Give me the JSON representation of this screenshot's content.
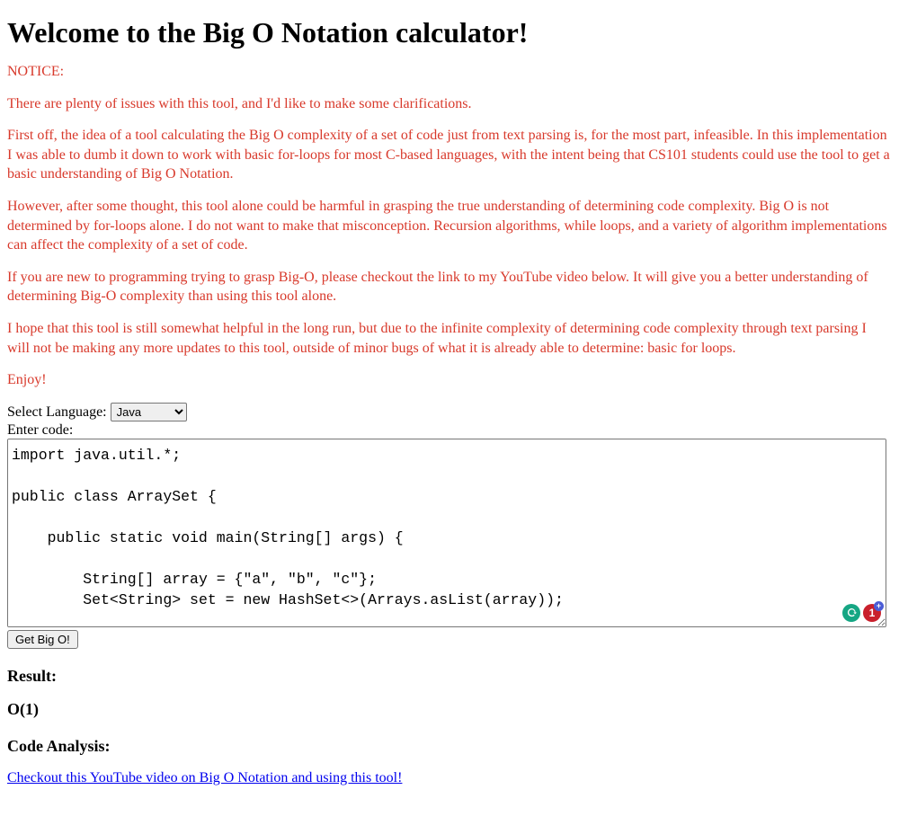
{
  "page_title": "Welcome to the Big O Notation calculator!",
  "notice": {
    "heading": "NOTICE:",
    "p1": "There are plenty of issues with this tool, and I'd like to make some clarifications.",
    "p2": "First off, the idea of a tool calculating the Big O complexity of a set of code just from text parsing is, for the most part, infeasible. In this implementation I was able to dumb it down to work with basic for-loops for most C-based languages, with the intent being that CS101 students could use the tool to get a basic understanding of Big O Notation.",
    "p3": "However, after some thought, this tool alone could be harmful in grasping the true understanding of determining code complexity. Big O is not determined by for-loops alone. I do not want to make that misconception. Recursion algorithms, while loops, and a variety of algorithm implementations can affect the complexity of a set of code.",
    "p4": "If you are new to programming trying to grasp Big-O, please checkout the link to my YouTube video below. It will give you a better understanding of determining Big-O complexity than using this tool alone.",
    "p5": "I hope that this tool is still somewhat helpful in the long run, but due to the infinite complexity of determining code complexity through text parsing I will not be making any more updates to this tool, outside of minor bugs of what it is already able to determine: basic for loops.",
    "p6": "Enjoy!"
  },
  "form": {
    "language_label": "Select Language:",
    "language_selected": "Java",
    "enter_code_label": "Enter code:",
    "code_text": "import java.util.*;\n\npublic class ArraySet {\n\n    public static void main(String[] args) {\n\n        String[] array = {\"a\", \"b\", \"c\"};\n        Set<String> set = new HashSet<>(Arrays.asList(array));\n\n        System.out.println(\"Set: \" + set);",
    "submit_label": "Get Big O!"
  },
  "result": {
    "heading": "Result:",
    "value": "O(1)"
  },
  "analysis": {
    "heading": "Code Analysis:"
  },
  "youtube_link_text": "Checkout this YouTube video on Big O Notation and using this tool!",
  "grammarly": {
    "count": "1"
  }
}
